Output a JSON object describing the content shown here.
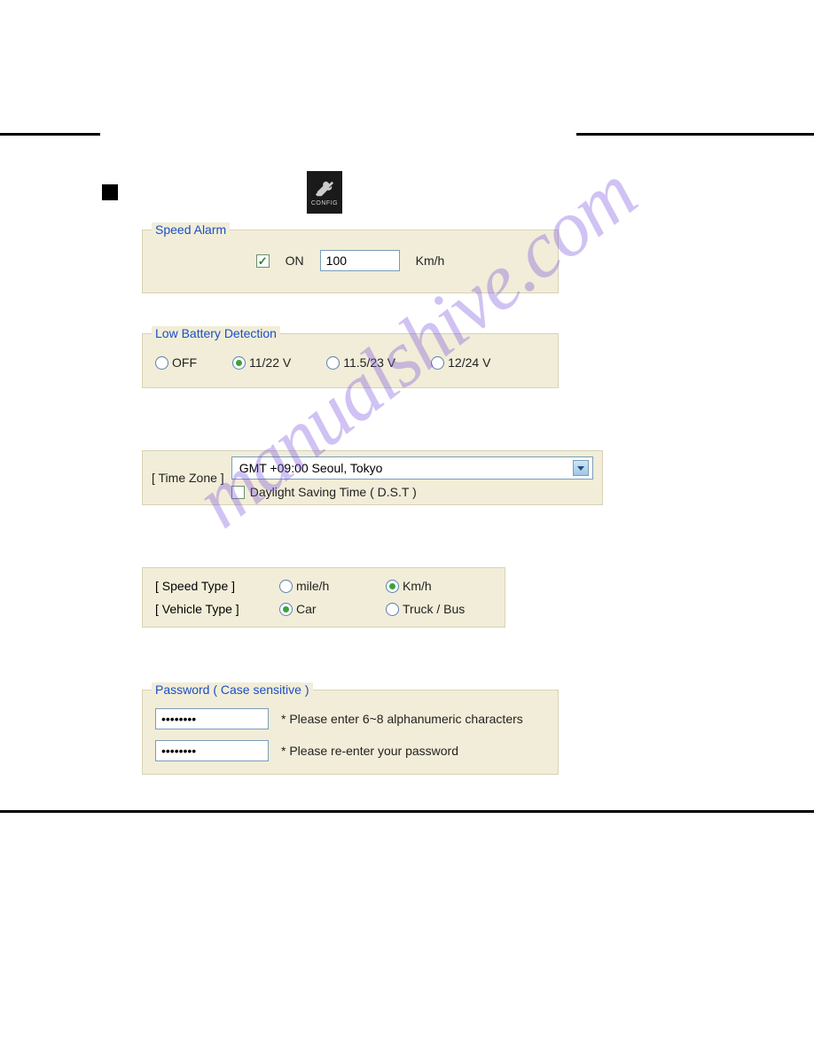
{
  "config_icon_label": "CONFIG",
  "speed_alarm": {
    "title": "Speed Alarm",
    "on_label": "ON",
    "on_checked": true,
    "value": "100",
    "unit": "Km/h"
  },
  "low_battery": {
    "title": "Low Battery Detection",
    "options": [
      {
        "label": "OFF",
        "checked": false
      },
      {
        "label": "11/22 V",
        "checked": true
      },
      {
        "label": "11.5/23 V",
        "checked": false
      },
      {
        "label": "12/24 V",
        "checked": false
      }
    ]
  },
  "time_zone": {
    "label": "[ Time Zone ]",
    "selected": "GMT +09:00 Seoul, Tokyo",
    "dst_label": "Daylight Saving Time ( D.S.T )",
    "dst_checked": false
  },
  "speed_type": {
    "label": "[ Speed  Type ]",
    "options": [
      {
        "label": "mile/h",
        "checked": false
      },
      {
        "label": "Km/h",
        "checked": true
      }
    ]
  },
  "vehicle_type": {
    "label": "[ Vehicle Type ]",
    "options": [
      {
        "label": "Car",
        "checked": true
      },
      {
        "label": "Truck / Bus",
        "checked": false
      }
    ]
  },
  "password": {
    "title": "Password ( Case sensitive )",
    "value1": "••••••••",
    "hint1": "* Please enter 6~8 alphanumeric characters",
    "value2": "••••••••",
    "hint2": "* Please re-enter your password"
  },
  "watermark": "manualshive.com"
}
